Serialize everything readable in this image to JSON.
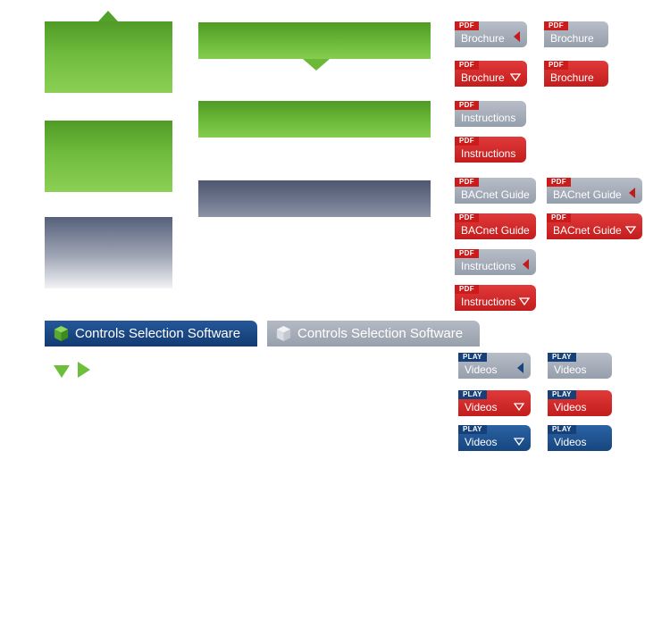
{
  "pdf_tag": "PDF",
  "play_tag": "PLAY",
  "buttons": {
    "brochure": "Brochure",
    "instructions": "Instructions",
    "bacnet_guide": "BACnet Guide",
    "videos": "Videos"
  },
  "tabs": {
    "active_label": "Controls Selection Software",
    "inactive_label": "Controls Selection Software"
  },
  "colors": {
    "green": "#6cb93a",
    "gray": "#a0a6b6",
    "red": "#c41d1d",
    "navy": "#17467f"
  }
}
